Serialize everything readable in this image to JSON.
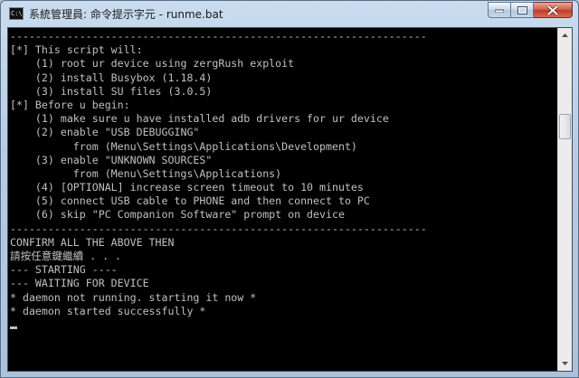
{
  "window": {
    "title": "系統管理員: 命令提示字元 - runme.bat",
    "icon_text": "C:\\."
  },
  "console": {
    "lines": [
      "------------------------------------------------------------------",
      "[*] This script will:",
      "    (1) root ur device using zergRush exploit",
      "    (2) install Busybox (1.18.4)",
      "    (3) install SU files (3.0.5)",
      "[*] Before u begin:",
      "    (1) make sure u have installed adb drivers for ur device",
      "    (2) enable \"USB DEBUGGING\"",
      "          from (Menu\\Settings\\Applications\\Development)",
      "    (3) enable \"UNKNOWN SOURCES\"",
      "          from (Menu\\Settings\\Applications)",
      "    (4) [OPTIONAL] increase screen timeout to 10 minutes",
      "    (5) connect USB cable to PHONE and then connect to PC",
      "    (6) skip \"PC Companion Software\" prompt on device",
      "------------------------------------------------------------------",
      "CONFIRM ALL THE ABOVE THEN",
      "請按任意鍵繼續 . . .",
      "--- STARTING ----",
      "--- WAITING FOR DEVICE",
      "* daemon not running. starting it now *",
      "* daemon started successfully *"
    ]
  },
  "caption_buttons": {
    "minimize": "minimize-icon",
    "maximize": "maximize-icon",
    "close": "close-icon"
  },
  "colors": {
    "console_bg": "#000000",
    "console_fg": "#c0c0c0",
    "close_button": "#c9482f"
  }
}
